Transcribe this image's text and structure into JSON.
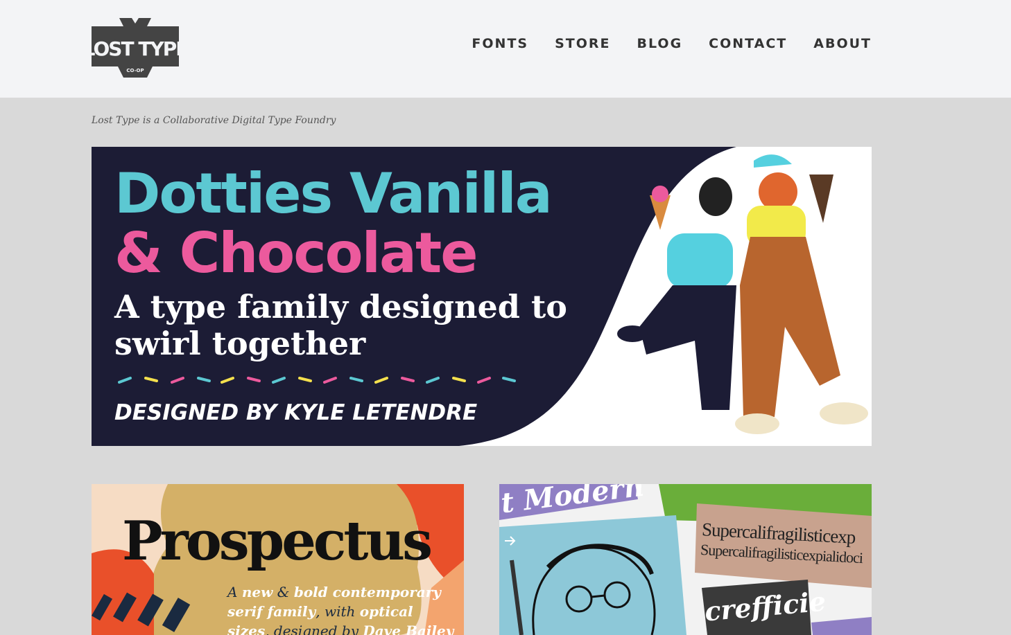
{
  "header": {
    "logo_text": "LOST TYPE",
    "logo_sub": "CO-OP",
    "nav": [
      "FONTS",
      "STORE",
      "BLOG",
      "CONTACT",
      "ABOUT"
    ]
  },
  "tagline": "Lost Type is a Collaborative Digital Type Foundry",
  "hero": {
    "line1": "Dotties Vanilla",
    "line2": "& Chocolate",
    "line3": "A type family designed to swirl together",
    "credit": "DESIGNED BY KYLE LETENDRE",
    "colors": {
      "bg": "#1c1c35",
      "teal": "#5cc8d2",
      "pink": "#ec5a9d",
      "yellow": "#f4e04d"
    }
  },
  "card_left": {
    "title": "Prospectus",
    "sub_a": "A",
    "sub_b": "new",
    "sub_c": "&",
    "sub_d": "bold contemporary",
    "sub_e": "serif family",
    "sub_f": ", with",
    "sub_g": "optical sizes",
    "sub_h": ",",
    "sub_i": "designed by",
    "sub_j": "Dave Bailey"
  },
  "card_right": {
    "word1": "t Modern",
    "super1": "Supercalifragilisticexp",
    "super2": "Supercalifragilisticexpialidoci",
    "effic": "crefficie"
  }
}
